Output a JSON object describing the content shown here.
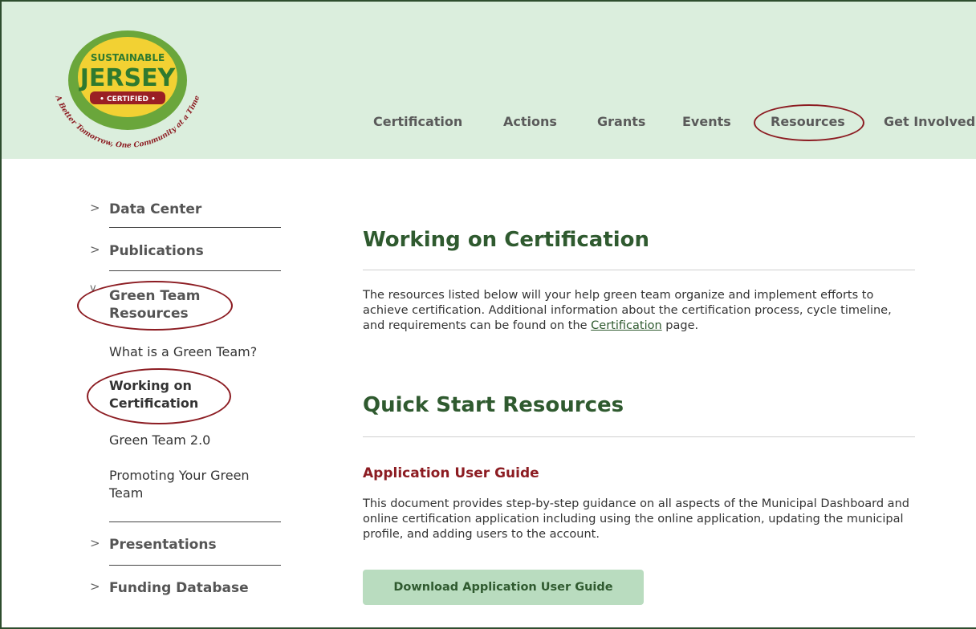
{
  "logo": {
    "line1": "SUSTAINABLE",
    "line2": "JERSEY",
    "badge": "• CERTIFIED •",
    "tagline": "A Better Tomorrow, One Community at a Time"
  },
  "nav": {
    "items": [
      "Certification",
      "Actions",
      "Grants",
      "Events",
      "Resources",
      "Get Involved"
    ]
  },
  "sidebar": {
    "sections": [
      {
        "label": "Data Center",
        "chevron": ">"
      },
      {
        "label": "Publications",
        "chevron": ">"
      },
      {
        "label": "Green Team Resources",
        "chevron": "v"
      },
      {
        "label": "Presentations",
        "chevron": ">"
      },
      {
        "label": "Funding Database",
        "chevron": ">"
      }
    ],
    "subitems": [
      "What is a Green Team?",
      "Working on Certification",
      "Green Team 2.0",
      "Promoting Your Green Team"
    ]
  },
  "main": {
    "title": "Working on Certification",
    "intro_before": "The resources listed below will your help green team organize and implement efforts to achieve certification. Additional information about the certification process, cycle timeline, and requirements can be found on the ",
    "intro_link": "Certification",
    "intro_after": " page.",
    "section_title": "Quick Start Resources",
    "resource_title": "Application User Guide",
    "resource_desc": "This document provides step-by-step guidance on all aspects of the Municipal Dashboard and online certification application including using the online application, updating the municipal profile, and adding users to the account.",
    "button_label": "Download Application User Guide"
  },
  "colors": {
    "header_bg": "#dbeedd",
    "heading_green": "#2f5a2f",
    "accent_red": "#8c1c22",
    "button_bg": "#b9dcbf"
  }
}
